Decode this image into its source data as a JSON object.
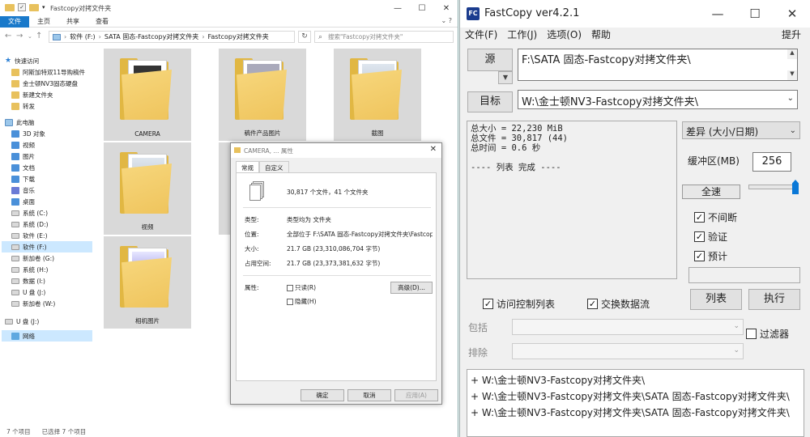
{
  "explorer": {
    "title": "Fastcopy对拷文件夹",
    "ribbon": {
      "file": "文件",
      "home": "主页",
      "share": "共享",
      "view": "查看"
    },
    "address": [
      "软件 (F:)",
      "SATA 固态-Fastcopy对拷文件夹",
      "Fastcopy对拷文件夹"
    ],
    "search_placeholder": "搜索\"Fastcopy对拷文件夹\"",
    "nav": {
      "quick_access": "快速访问",
      "pinned": [
        "阿斯加特双11导购稿件",
        "金士顿NV3固态硬盘",
        "新建文件夹",
        "转发"
      ],
      "this_pc": "此电脑",
      "pc_items": [
        "3D 对象",
        "视频",
        "图片",
        "文档",
        "下载",
        "音乐",
        "桌面"
      ],
      "drives": [
        "系统 (C:)",
        "系统 (D:)",
        "软件 (E:)",
        "软件 (F:)",
        "新加卷 (G:)",
        "系统 (H:)",
        "数据 (I:)",
        "U 盘 (J:)",
        "新加卷 (W:)"
      ],
      "usb": "U 盘 (J:)",
      "network": "网络"
    },
    "folders": [
      "CAMERA",
      "稿件产品图片",
      "截图",
      "视频",
      "相机图片"
    ],
    "status": {
      "count": "7 个项目",
      "selected": "已选择 7 个项目"
    }
  },
  "props": {
    "title": "CAMERA, ... 属性",
    "tabs": [
      "常规",
      "自定义"
    ],
    "summary": "30,817 个文件，41 个文件夹",
    "type_label": "类型:",
    "type_value": "类型均为 文件夹",
    "loc_label": "位置:",
    "loc_value": "全部位于 F:\\SATA 固态-Fastcopy对拷文件夹\\Fastcopy对",
    "size_label": "大小:",
    "size_value": "21.7 GB (23,310,086,704 字节)",
    "disk_label": "占用空间:",
    "disk_value": "21.7 GB (23,373,381,632 字节)",
    "attr_label": "属性:",
    "readonly": "只读(R)",
    "hidden": "隐藏(H)",
    "advanced": "高级(D)...",
    "ok": "确定",
    "cancel": "取消",
    "apply": "应用(A)"
  },
  "fastcopy": {
    "title": "FastCopy ver4.2.1",
    "menu": [
      "文件(F)",
      "工作(J)",
      "选项(O)",
      "帮助"
    ],
    "menu_right": "提升",
    "source_btn": "源",
    "source_path": "F:\\SATA 固态-Fastcopy对拷文件夹\\",
    "dest_btn": "目标",
    "dest_path": "W:\\金士顿NV3-Fastcopy对拷文件夹\\",
    "log": "总大小 = 22,230 MiB\n总文件 = 30,817 (44)\n总时间 = 0.6 秒\n\n---- 列表 完成 ----",
    "mode": "差异 (大小/日期)",
    "buffer_label": "缓冲区(MB)",
    "buffer_value": "256",
    "full_speed": "全速",
    "speed_level": 1.0,
    "opt_nonstop": "不间断",
    "opt_verify": "验证",
    "opt_estimate": "预计",
    "acl": "访问控制列表",
    "streams": "交换数据流",
    "list_btn": "列表",
    "exec_btn": "执行",
    "include": "包括",
    "exclude": "排除",
    "filter": "过滤器",
    "paths": [
      "+ W:\\金士顿NV3-Fastcopy对拷文件夹\\",
      "+ W:\\金士顿NV3-Fastcopy对拷文件夹\\SATA 固态-Fastcopy对拷文件夹\\",
      "+ W:\\金士顿NV3-Fastcopy对拷文件夹\\SATA 固态-Fastcopy对拷文件夹\\"
    ]
  }
}
